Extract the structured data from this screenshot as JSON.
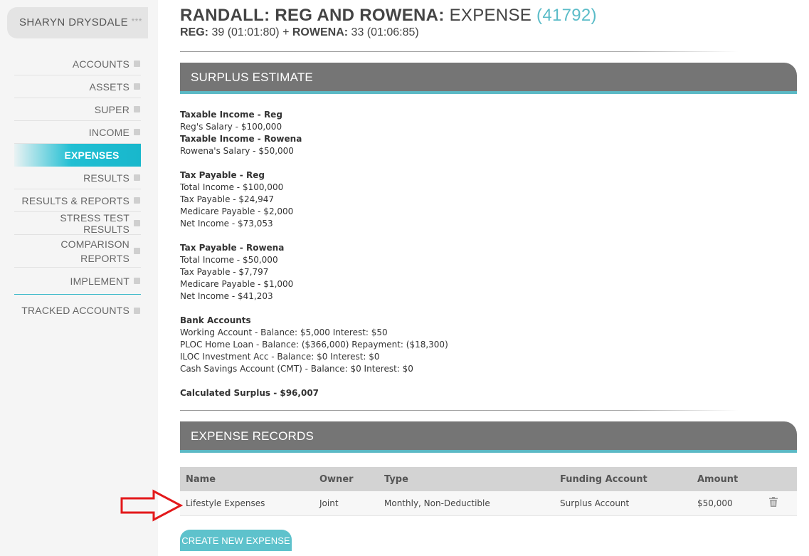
{
  "sidebar": {
    "user_name": "SHARYN DRYSDALE",
    "user_stars": "***",
    "items": [
      {
        "label": "ACCOUNTS"
      },
      {
        "label": "ASSETS"
      },
      {
        "label": "SUPER"
      },
      {
        "label": "INCOME"
      },
      {
        "label": "EXPENSES",
        "active": true
      },
      {
        "label": "RESULTS"
      },
      {
        "label": "RESULTS & REPORTS"
      },
      {
        "label": "STRESS TEST RESULTS"
      },
      {
        "label_line1": "COMPARISON",
        "label_line2": "REPORTS"
      },
      {
        "label": "IMPLEMENT"
      },
      {
        "label": "TRACKED ACCOUNTS"
      }
    ]
  },
  "header": {
    "client_names": "RANDALL: REG AND ROWENA:",
    "section": "EXPENSE",
    "client_number": "(41792)",
    "reg_label": "REG:",
    "reg_detail": "39 (01:01:80) +",
    "rowena_label": "ROWENA:",
    "rowena_detail": "33 (01:06:85)"
  },
  "surplus": {
    "heading": "SURPLUS ESTIMATE",
    "lines": {
      "l1": "Taxable Income - Reg",
      "l2": "Reg's Salary - $100,000",
      "l3": "Taxable Income - Rowena",
      "l4": "Rowena's Salary - $50,000",
      "l5": "Tax Payable - Reg",
      "l6": "Total Income - $100,000",
      "l7": "Tax Payable - $24,947",
      "l8": "Medicare Payable - $2,000",
      "l9": "Net Income - $73,053",
      "l10": "Tax Payable - Rowena",
      "l11": "Total Income - $50,000",
      "l12": "Tax Payable - $7,797",
      "l13": "Medicare Payable - $1,000",
      "l14": "Net Income - $41,203",
      "l15": "Bank Accounts",
      "l16": "Working Account - Balance: $5,000 Interest: $50",
      "l17": "PLOC Home Loan - Balance: ($366,000) Repayment: ($18,300)",
      "l18": "ILOC Investment Acc - Balance: $0 Interest: $0",
      "l19": "Cash Savings Account (CMT) - Balance: $0 Interest: $0",
      "l20": "Calculated Surplus - $96,007"
    }
  },
  "records": {
    "heading": "EXPENSE RECORDS",
    "columns": {
      "name": "Name",
      "owner": "Owner",
      "type": "Type",
      "funding": "Funding Account",
      "amount": "Amount"
    },
    "rows": [
      {
        "name": "Lifestyle Expenses",
        "owner": "Joint",
        "type": "Monthly, Non-Deductible",
        "funding": "Surplus Account",
        "amount": "$50,000",
        "action_icon": "trash-icon"
      }
    ],
    "create_label": "CREATE NEW EXPENSE"
  },
  "colors": {
    "accent": "#21bfd3",
    "panel": "#757575",
    "arrow": "#e3191b"
  }
}
